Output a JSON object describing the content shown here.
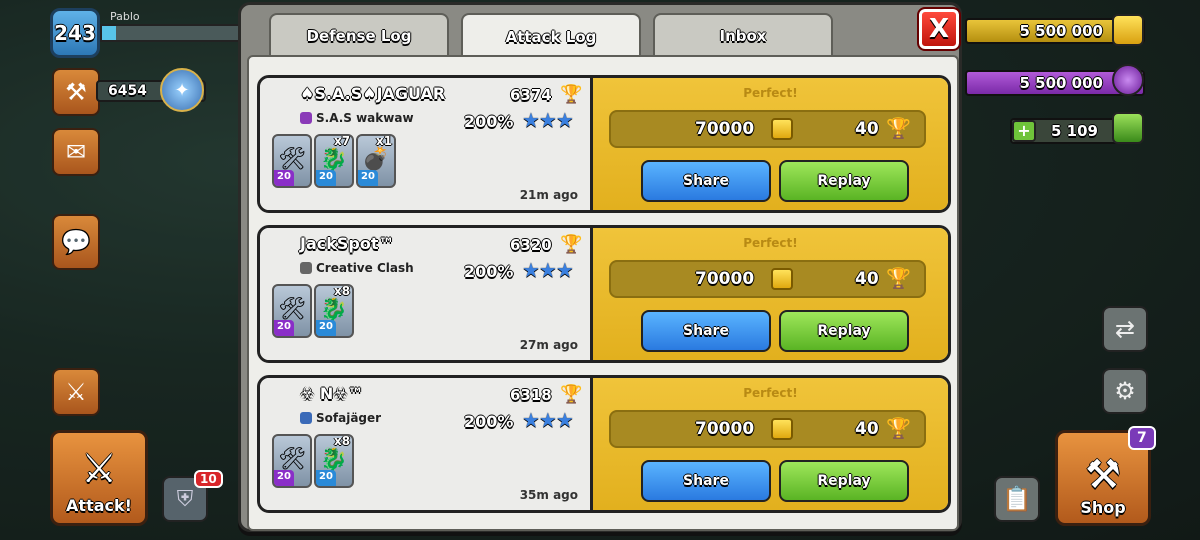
{
  "hud": {
    "player_level": "243",
    "player_name": "Pablo",
    "xp_progress": 0.1,
    "trophies": "6454",
    "attack_label": "Attack!",
    "shield_notification": "10",
    "shop_label": "Shop",
    "shop_notification": "7",
    "gold": "5 500 000",
    "elixir": "5 500 000",
    "gems": "5 109"
  },
  "modal": {
    "tabs": [
      {
        "label": "Defense Log",
        "active": false
      },
      {
        "label": "Attack Log",
        "active": true
      },
      {
        "label": "Inbox",
        "active": false
      }
    ],
    "close_label": "X"
  },
  "entries": [
    {
      "name": "♠S.A.S♠JAGUAR",
      "clan": "S.A.S wakwaw",
      "clan_color": "#8a3ab8",
      "trophies": "6374",
      "percent": "200%",
      "stars": "★★★",
      "troops": [
        {
          "count": "",
          "level": "20",
          "icon": "machine",
          "lvl_color": "purple"
        },
        {
          "count": "x7",
          "level": "20",
          "icon": "baby-dragon",
          "lvl_color": "blue"
        },
        {
          "count": "x1",
          "level": "20",
          "icon": "cannon",
          "lvl_color": "blue"
        }
      ],
      "time": "21m ago",
      "result": "Perfect!",
      "gold": "70000",
      "trophy_gain": "40",
      "share": "Share",
      "replay": "Replay"
    },
    {
      "name": "JackSpot™",
      "clan": "Creative Clash",
      "clan_color": "#666666",
      "trophies": "6320",
      "percent": "200%",
      "stars": "★★★",
      "troops": [
        {
          "count": "",
          "level": "20",
          "icon": "machine",
          "lvl_color": "purple"
        },
        {
          "count": "x8",
          "level": "20",
          "icon": "baby-dragon",
          "lvl_color": "blue"
        }
      ],
      "time": "27m ago",
      "result": "Perfect!",
      "gold": "70000",
      "trophy_gain": "40",
      "share": "Share",
      "replay": "Replay"
    },
    {
      "name": "☣ N☣™",
      "clan": "Sofajäger",
      "clan_color": "#3a6ab8",
      "trophies": "6318",
      "percent": "200%",
      "stars": "★★★",
      "troops": [
        {
          "count": "",
          "level": "20",
          "icon": "machine",
          "lvl_color": "purple"
        },
        {
          "count": "x8",
          "level": "20",
          "icon": "baby-dragon",
          "lvl_color": "blue"
        }
      ],
      "time": "35m ago",
      "result": "Perfect!",
      "gold": "70000",
      "trophy_gain": "40",
      "share": "Share",
      "replay": "Replay"
    }
  ]
}
